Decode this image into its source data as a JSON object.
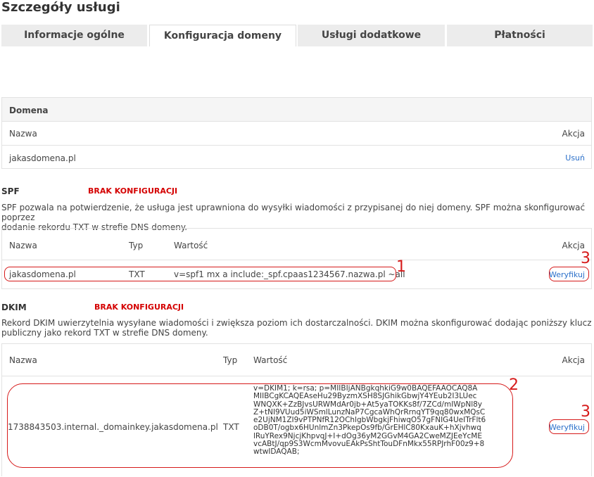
{
  "page": {
    "title": "Szczegóły usługi"
  },
  "tabs": [
    {
      "label": "Informacje ogólne"
    },
    {
      "label": "Konfiguracja domeny"
    },
    {
      "label": "Usługi dodatkowe"
    },
    {
      "label": "Płatności"
    }
  ],
  "active_tab": "Konfiguracja domeny",
  "domain_box": {
    "header": "Domena",
    "col_name": "Nazwa",
    "col_action": "Akcja",
    "rows": [
      {
        "name": "jakasdomena.pl",
        "action": "Usuń"
      }
    ]
  },
  "spf": {
    "label": "SPF",
    "status": "BRAK KONFIGURACJI",
    "desc_line1": "SPF pozwala na potwierdzenie, że usługa jest uprawniona do wysyłki wiadomości z przypisanej do niej domeny. SPF można skonfigurować poprzez",
    "desc_line2": "dodanie rekordu TXT w strefie DNS domeny.",
    "col_name": "Nazwa",
    "col_type": "Typ",
    "col_value": "Wartość",
    "col_action": "Akcja",
    "row": {
      "name": "jakasdomena.pl",
      "type": "TXT",
      "value": "v=spf1 mx a include:_spf.cpaas1234567.nazwa.pl ~all",
      "action": "Weryfikuj"
    }
  },
  "dkim": {
    "label": "DKIM",
    "status": "BRAK KONFIGURACJI",
    "desc_line1": "Rekord DKIM uwierzytelnia wysyłane wiadomości i zwiększa poziom ich dostarczalności. DKIM można skonfigurować dodając poniższy klucz",
    "desc_line2": "publiczny jako rekord TXT w strefie DNS domeny.",
    "col_name": "Nazwa",
    "col_type": "Typ",
    "col_value": "Wartość",
    "col_action": "Akcja",
    "row": {
      "name": "1738843503.internal._domainkey.jakasdomena.pl",
      "type": "TXT",
      "value_lines": [
        "v=DKIM1; k=rsa; p=MIIBIjANBgkqhkiG9w0BAQEFAAOCAQ8A",
        "MIIBCgKCAQEAseHu29ByzmXSH8SJGhikGbwjY4YEub2I3LUec",
        "WNQXK+ZzBJvsURWMdAr0jb+At5yaTOKKs8f/7ZCd/mIWpNl8y",
        "Z+tNI9VUud5iWSmlLunzNaP7CgcaWhQrRrnqYT9qq80wxMQsC",
        "e2UjNM1ZI9vPTPNfR12OChlgbWbgkjFhiwqO57gFNIG4UeITrFlt6",
        "oDB0T/ogbx6HUnlmZn3PkepOs9fb/GrEHlC80KxauK+hXjvhwq",
        "lRuYRex9NjcjKhpvqJ+I+dOg36yM2GGvM4GA2CweMZJEeYcME",
        "vcABtJ/qp9S3WcmMvovuEAkPsShtTouDFnMkx55RPJrhF00z9+8",
        "wtwIDAQAB;"
      ],
      "action": "Weryfikuj"
    }
  },
  "annotations": {
    "one": "1",
    "two": "2",
    "three_a": "3",
    "three_b": "3"
  },
  "colors": {
    "annotation": "#d61a1a",
    "status_red": "#d40000",
    "link_blue": "#2a6fc9",
    "tab_bg": "#ececec"
  }
}
